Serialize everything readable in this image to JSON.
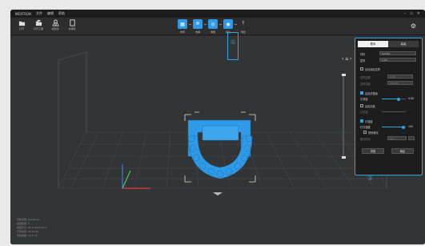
{
  "window": {
    "app_name": "MEXTRON",
    "menus": [
      "文件",
      "编辑",
      "帮助"
    ]
  },
  "toolbar": {
    "left_items": [
      {
        "label": "打开",
        "icon": "folder-icon"
      },
      {
        "label": "打开工程",
        "icon": "project-icon"
      },
      {
        "label": "模型库",
        "icon": "library-icon"
      },
      {
        "label": "支撑库",
        "icon": "file-icon"
      }
    ],
    "steps": [
      {
        "label": "布局",
        "icon": "layout-icon",
        "active": true
      },
      {
        "label": "支撑",
        "icon": "support-icon",
        "active": true
      },
      {
        "label": "测量",
        "icon": "measure-icon",
        "active": true
      },
      {
        "label": "切片",
        "icon": "slice-icon",
        "active": true
      },
      {
        "label": "导出",
        "icon": "export-icon",
        "active": false
      }
    ]
  },
  "callouts": {
    "toolbar_marker": "①",
    "panel_marker": "②"
  },
  "panel": {
    "tabs": [
      "基本",
      "高级"
    ],
    "material_label": "材料",
    "material_value": "Dental",
    "layer_label": "层厚",
    "layer_value": "0.05",
    "auto_support_label": "自动添加支撑",
    "field_a_label": "支撑密度",
    "field_a_value": "0.50",
    "field_b_label": "支撑高度",
    "field_b_value": "100.00",
    "enable_a_label": "启用抗锯齿",
    "slider_a_label": "平滑度",
    "slider_a_value": "0.80",
    "slider_a_fraction": 0.7,
    "enable_b_label": "启用灰度",
    "enable_c_label": "灯光值",
    "enable_d_label": "灯强度",
    "light_label": "灯光强度",
    "light_value": "100",
    "light_fraction": 0.9,
    "disable_label": "禁用曝光",
    "exposure_label": "曝光时间",
    "exposure_value": "10",
    "btn_reset": "重置",
    "btn_apply": "确定"
  },
  "status": {
    "lines": [
      "文件名称: Dental.stl",
      "模型数量: 1",
      "模型尺寸: 55.2x48.6x21.4",
      "打印时间: 00:42:10",
      "材料用量: 12.6 ml"
    ]
  },
  "colors": {
    "accent": "#2aa7e0",
    "model": "#2f9be8"
  }
}
